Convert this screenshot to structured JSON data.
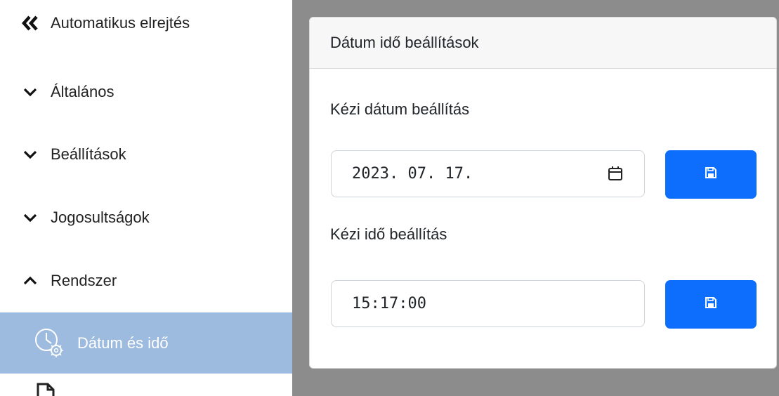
{
  "sidebar": {
    "items": [
      {
        "label": "Automatikus elrejtés",
        "icon": "double-chevron-left-icon"
      },
      {
        "label": "Általános",
        "icon": "chevron-down-icon"
      },
      {
        "label": "Beállítások",
        "icon": "chevron-down-icon"
      },
      {
        "label": "Jogosultságok",
        "icon": "chevron-down-icon"
      },
      {
        "label": "Rendszer",
        "icon": "chevron-up-icon"
      },
      {
        "label": "Dátum és idő",
        "icon": "clock-gear-icon",
        "active": true
      }
    ]
  },
  "card": {
    "title": "Dátum idő beállítások",
    "date_label": "Kézi dátum beállítás",
    "date_value": "2023. 07. 17.",
    "time_label": "Kézi idő beállítás",
    "time_value": "15:17:00"
  },
  "colors": {
    "accent": "#0d6efd",
    "active_sidebar": "#9dbbdf",
    "backdrop": "#8c8c8c"
  }
}
